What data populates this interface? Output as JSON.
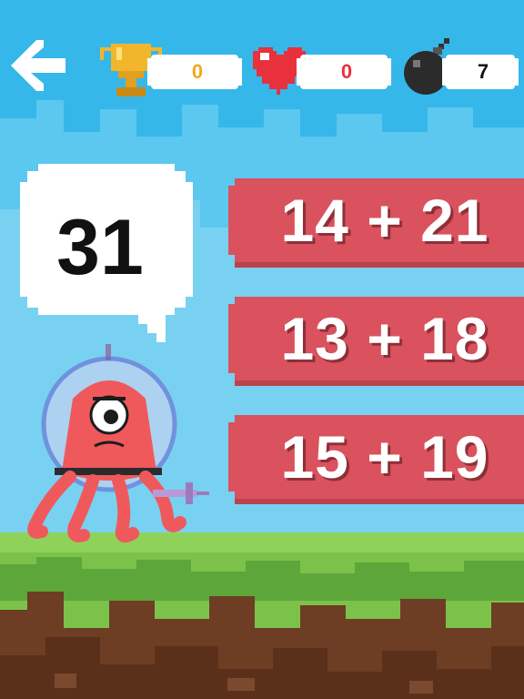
{
  "hud": {
    "trophy_score": "0",
    "hearts": "0",
    "bombs": "7"
  },
  "question": {
    "target": "31"
  },
  "answers": [
    {
      "label": "14 + 21"
    },
    {
      "label": "13 + 18"
    },
    {
      "label": "15 + 19"
    }
  ],
  "colors": {
    "sky": "#35b7ea",
    "answer_button": "#d9525e",
    "grass": "#7cc24a",
    "dirt": "#6d3d24"
  },
  "icons": [
    "back-arrow-icon",
    "trophy-icon",
    "heart-icon",
    "bomb-icon",
    "octopus-alien-character"
  ]
}
